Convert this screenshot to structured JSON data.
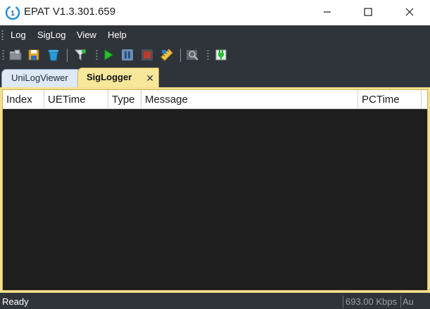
{
  "window": {
    "title": "EPAT V1.3.301.659"
  },
  "menu": {
    "items": [
      "Log",
      "SigLog",
      "View",
      "Help"
    ]
  },
  "toolbar": {
    "buttons": [
      "open-folder-icon",
      "save-icon",
      "clear-icon",
      "filter-icon",
      "play-icon",
      "pause-icon",
      "stop-icon",
      "ruler-icon",
      "search-icon",
      "connect-plug-icon"
    ]
  },
  "tabs": [
    {
      "label": "UniLogViewer",
      "active": false
    },
    {
      "label": "SigLogger",
      "active": true,
      "close": "✕"
    }
  ],
  "table": {
    "columns": [
      "Index",
      "UETime",
      "Type",
      "Message",
      "PCTime"
    ],
    "rows": []
  },
  "status": {
    "text": "Ready",
    "rate": "693.00 Kbps",
    "extra": "Au"
  },
  "colors": {
    "chrome": "#2f343a",
    "active_tab": "#f6e79a",
    "inactive_tab": "#dfe9f5",
    "data_background": "#1e1e1e",
    "play": "#27c22e",
    "stop": "#c0392b",
    "pause": "#6a8fb8"
  }
}
